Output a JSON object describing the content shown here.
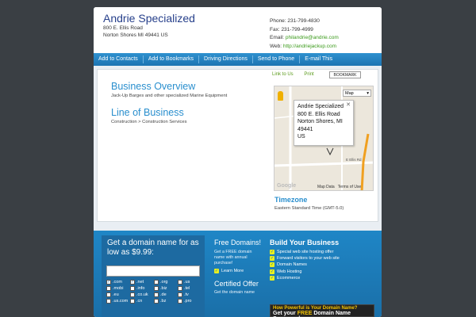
{
  "business": {
    "name": "Andrie Specialized",
    "address_line1": "800 E. Ellis Road",
    "address_line2": "Norton Shores MI 49441 US"
  },
  "contact": {
    "phone": "Phone: 231-799-4830",
    "fax": "Fax: 231-799-4999",
    "email_label": "Email: ",
    "email": "philandrie@andrie.com",
    "web_label": "Web: ",
    "web": "http://andriejackup.com"
  },
  "nav": {
    "items": [
      "Add to Contacts",
      "Add to Bookmarks",
      "Driving Directions",
      "Send to Phone",
      "E-mail This"
    ]
  },
  "utility": {
    "link_to_us": "Link to Us",
    "print": "Print",
    "bookmark": "BOOKMARK"
  },
  "overview": {
    "title": "Business Overview",
    "text": "Jack-Up Barges and other specialized Marine Equipment"
  },
  "line_of_business": {
    "title": "Line of Business",
    "text": "Construction > Construction Services"
  },
  "map": {
    "type_label": "Map",
    "info_name": "Andrie Specialized",
    "info_addr1": "800 E. Ellis Road",
    "info_addr2": "Norton Shores, MI",
    "info_zip": "49441",
    "info_country": "US",
    "brand": "Google",
    "map_data": "Map Data",
    "terms": "Terms of Use",
    "road_label": "E Ellis Rd"
  },
  "timezone": {
    "title": "Timezone",
    "value": "Eastern Standard Time (GMT-5.0)"
  },
  "domain": {
    "title": "Get a domain name for as low as $9.99:",
    "tlds": [
      {
        "label": ".com",
        "checked": true
      },
      {
        "label": ".net",
        "checked": true
      },
      {
        "label": ".org",
        "checked": false
      },
      {
        "label": ".us",
        "checked": false
      },
      {
        "label": ".mobi",
        "checked": false
      },
      {
        "label": ".info",
        "checked": false
      },
      {
        "label": ".biz",
        "checked": false
      },
      {
        "label": ".tel",
        "checked": false
      },
      {
        "label": ".eu",
        "checked": false
      },
      {
        "label": ".co.uk",
        "checked": false
      },
      {
        "label": ".de",
        "checked": false
      },
      {
        "label": ".tv",
        "checked": false
      },
      {
        "label": ".us.com",
        "checked": false
      },
      {
        "label": ".cn",
        "checked": false
      },
      {
        "label": ".bz",
        "checked": false
      },
      {
        "label": ".pro",
        "checked": false
      }
    ]
  },
  "free_domains": {
    "title": "Free Domains!",
    "text": "Get a FREE domain name with annual purchase!",
    "learn_more": "Learn More"
  },
  "certified": {
    "title": "Certified Offer",
    "text": "Get the domain name"
  },
  "build": {
    "title": "Build Your Business",
    "items": [
      "Special web site hosting offer",
      "Forward visitors to your web site",
      "Domain Names",
      "Web Hosting",
      "Ecommerce"
    ]
  },
  "promo": {
    "line1": "How Powerful is Your Domain Name?",
    "line2_pre": "Get your ",
    "line2_em": "FREE",
    "line2_post": " Domain Name Scorecard"
  },
  "colors": {
    "accent": "#2a8fce",
    "nav_blue": "#1c74b2",
    "link_green": "#3a9a1a",
    "background": "#3a3f44"
  }
}
